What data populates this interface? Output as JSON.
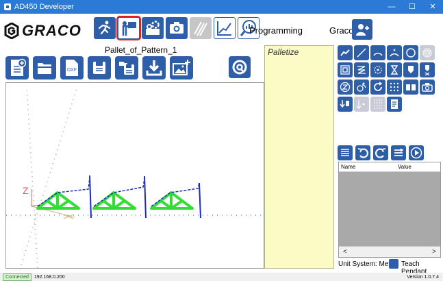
{
  "window": {
    "title": "AD450 Developer",
    "minimize_glyph": "—",
    "maximize_glyph": "☐",
    "close_glyph": "✕"
  },
  "header": {
    "logo_text": "GRACO",
    "mode_label": "Programming",
    "user_name": "Graco",
    "nav_icons": [
      "dispense-run-icon",
      "program-teach-icon",
      "settings-config-icon",
      "camera-icon",
      "hatch-disabled-icon",
      "chart-icon",
      "gauge-icon"
    ],
    "active_icon": "program-teach-icon"
  },
  "editor": {
    "pattern_name": "Pallet_of_Pattern_1",
    "file_tools": [
      "new-file-icon",
      "open-folder-icon",
      "dxf-import-icon",
      "save-icon",
      "save-as-icon",
      "download-icon",
      "add-image-icon"
    ],
    "dxf_label": "DXF",
    "refresh_tool": "refresh-icon"
  },
  "viewport": {
    "axis_label": "Z"
  },
  "program_panel": {
    "title": "Palletize"
  },
  "tool_palette": {
    "rows": [
      [
        "move-icon",
        "line-icon",
        "arc-icon",
        "arc-3pt-icon",
        "circle-icon",
        "spiral-icon"
      ],
      [
        "rectangle-spiral-icon",
        "zigzag-icon",
        "point-icon",
        "wait-icon",
        "dispense-on-icon",
        "dispense-off-icon"
      ],
      [
        "z-move-icon",
        "rotate-icon",
        "loop-icon",
        "grid-array-icon",
        "book-icon",
        "camera-icon"
      ],
      [
        "tool-down-icon",
        "step-disabled-icon",
        "grid-disabled-icon",
        "notes-icon"
      ]
    ]
  },
  "properties": {
    "toolbar": [
      "list-icon",
      "undo-icon",
      "redo-icon",
      "filter-icon",
      "run-icon"
    ],
    "col_name": "Name",
    "col_value": "Value",
    "scroll_left": "<",
    "scroll_right": ">",
    "unit_system": "Unit System: Metric",
    "teach_pendant": "Teach Pendant"
  },
  "status": {
    "connection": "Connected",
    "ip": "192.168.0.200",
    "version": "Version 1.0.7.4"
  },
  "colors": {
    "accent": "#2f5ea8",
    "titlebar": "#2a7ad6",
    "pattern_green": "#33dd33",
    "path_blue": "#1a2fbf",
    "panel_yellow": "#fbfbc6"
  }
}
